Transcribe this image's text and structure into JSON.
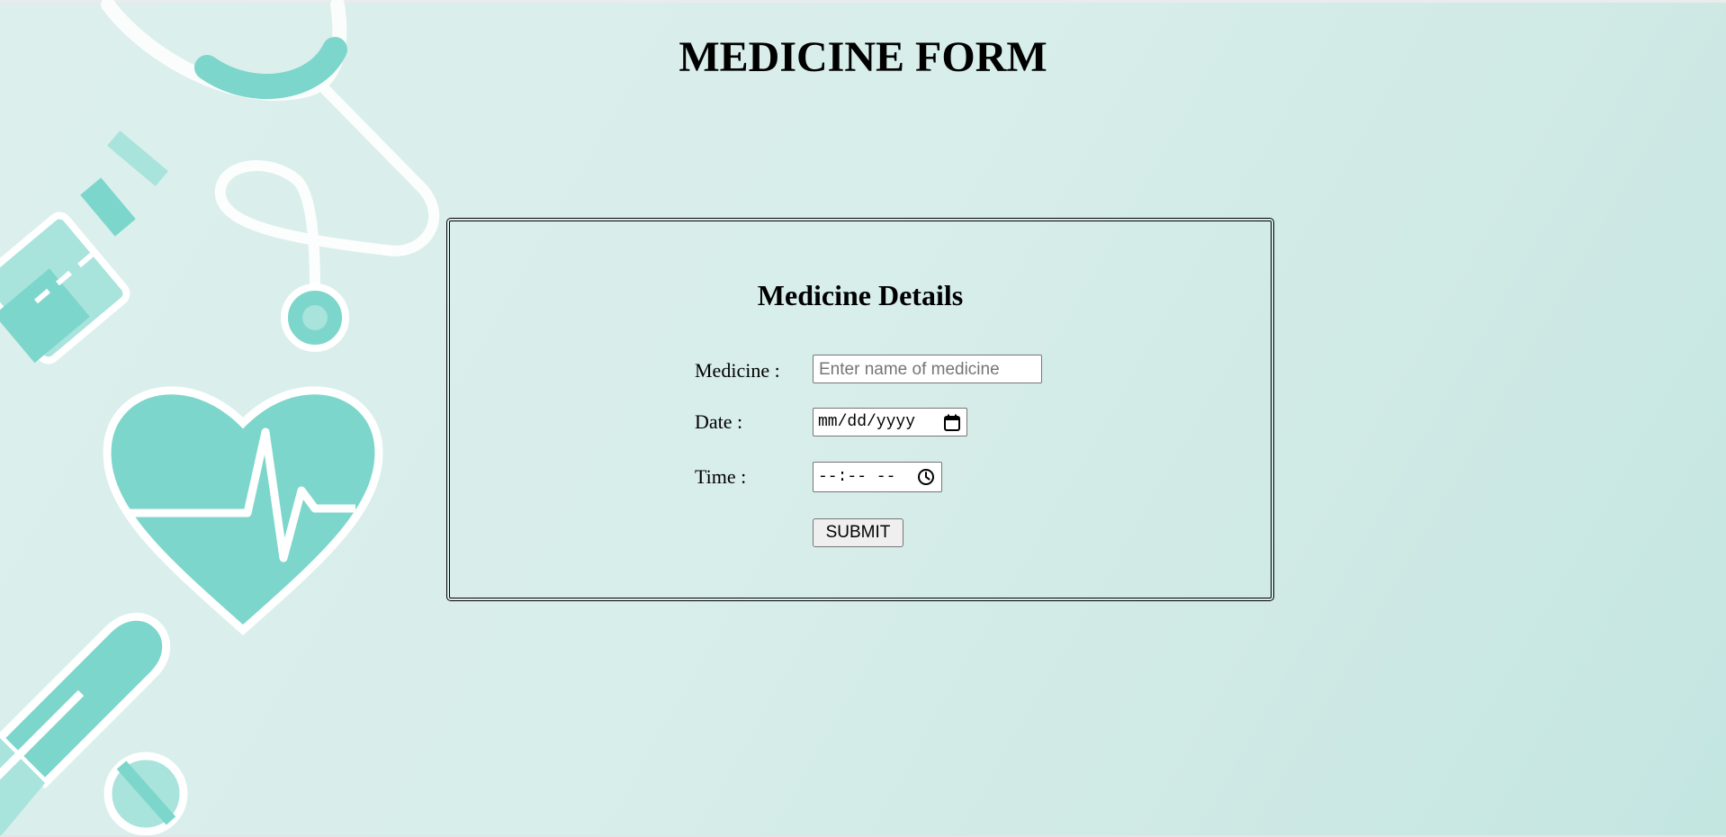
{
  "page": {
    "title": "MEDICINE FORM"
  },
  "form": {
    "heading": "Medicine Details",
    "medicine": {
      "label": "Medicine :",
      "placeholder": "Enter name of medicine",
      "value": ""
    },
    "date": {
      "label": "Date :",
      "display": "mm/dd/yyyy",
      "icon": "calendar-icon"
    },
    "time": {
      "label": "Time :",
      "display": "--:-- --",
      "icon": "clock-icon"
    },
    "submit_label": "SUBMIT"
  },
  "colors": {
    "background": "#d8eeea",
    "decor_teal": "#7dd6cb",
    "decor_light": "#a8e3dc",
    "card_border": "#000000"
  }
}
